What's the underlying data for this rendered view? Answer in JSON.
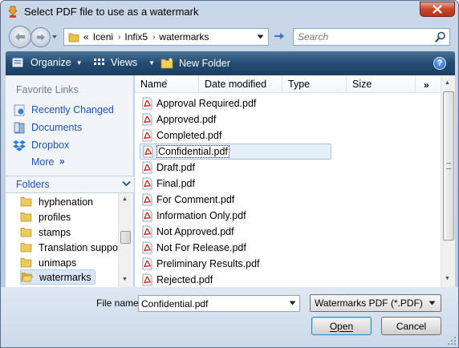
{
  "window": {
    "title": "Select PDF file to use as a watermark",
    "close_icon": "close-icon"
  },
  "address": {
    "overflow": "«",
    "crumbs": [
      "Iceni",
      "Infix5",
      "watermarks"
    ],
    "separator": "›"
  },
  "search": {
    "placeholder": "Search"
  },
  "commands": {
    "organize": "Organize",
    "views": "Views",
    "new_folder": "New Folder",
    "help": "?"
  },
  "favorites": {
    "heading": "Favorite Links",
    "links": [
      "Recently Changed",
      "Documents",
      "Dropbox"
    ],
    "more": "More",
    "more_arrow": "»"
  },
  "folders": {
    "label": "Folders",
    "items": [
      "hyphenation",
      "profiles",
      "stamps",
      "Translation suppor",
      "unimaps",
      "watermarks"
    ],
    "selected_index": 5
  },
  "columns": {
    "name": "Name",
    "date_modified": "Date modified",
    "type": "Type",
    "size": "Size",
    "more": "»"
  },
  "files": [
    "Approval Required.pdf",
    "Approved.pdf",
    "Completed.pdf",
    "Confidential.pdf",
    "Draft.pdf",
    "Final.pdf",
    "For Comment.pdf",
    "Information Only.pdf",
    "Not Approved.pdf",
    "Not For Release.pdf",
    "Preliminary Results.pdf",
    "Rejected.pdf"
  ],
  "selected_file_index": 3,
  "bottom": {
    "filename_label": "File name:",
    "filename_value": "Confidential.pdf",
    "filetype": "Watermarks PDF (*.PDF)",
    "open": "Open",
    "cancel": "Cancel"
  },
  "colors": {
    "accent": "#1c52b6",
    "command_bar": "#234b72",
    "pdf_red": "#c8201f"
  }
}
